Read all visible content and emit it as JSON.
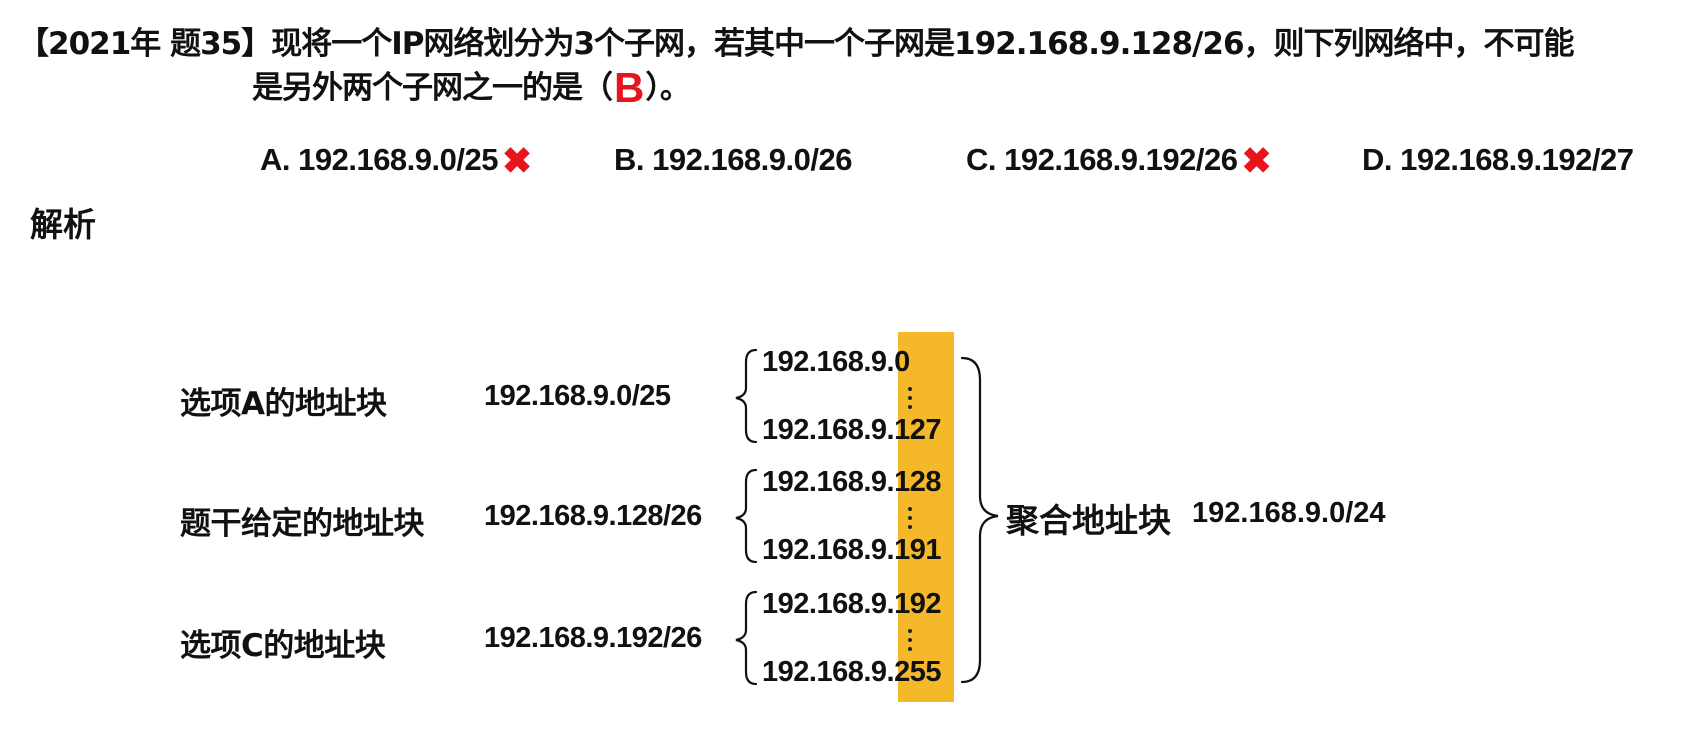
{
  "question": {
    "line1": "【2021年 题35】现将一个IP网络划分为3个子网，若其中一个子网是192.168.9.128/26，则下列网络中，不可能",
    "line2_before": "是另外两个子网之一的是（",
    "answer": "B",
    "line2_after": "）。"
  },
  "options": [
    {
      "text": "A. 192.168.9.0/25",
      "mark": "✖"
    },
    {
      "text": "B. 192.168.9.0/26",
      "mark": ""
    },
    {
      "text": "C. 192.168.9.192/26",
      "mark": "✖"
    },
    {
      "text": "D. 192.168.9.192/27",
      "mark": ""
    }
  ],
  "analysis_title": "解析",
  "rows": [
    {
      "label": "选项A的地址块",
      "block": "192.168.9.0/25",
      "start_prefix": "192.168.9.",
      "start_host": "0",
      "end_prefix": "192.168.9.",
      "end_host": "127"
    },
    {
      "label": "题干给定的地址块",
      "block": "192.168.9.128/26",
      "start_prefix": "192.168.9.",
      "start_host": "128",
      "end_prefix": "192.168.9.",
      "end_host": "191"
    },
    {
      "label": "选项C的地址块",
      "block": "192.168.9.192/26",
      "start_prefix": "192.168.9.",
      "start_host": "192",
      "end_prefix": "192.168.9.",
      "end_host": "255"
    }
  ],
  "aggregate": {
    "label": "聚合地址块",
    "block": "192.168.9.0/24"
  },
  "colors": {
    "highlight": "#f5b82a",
    "answer_red": "#e8141c",
    "text": "#111111"
  }
}
